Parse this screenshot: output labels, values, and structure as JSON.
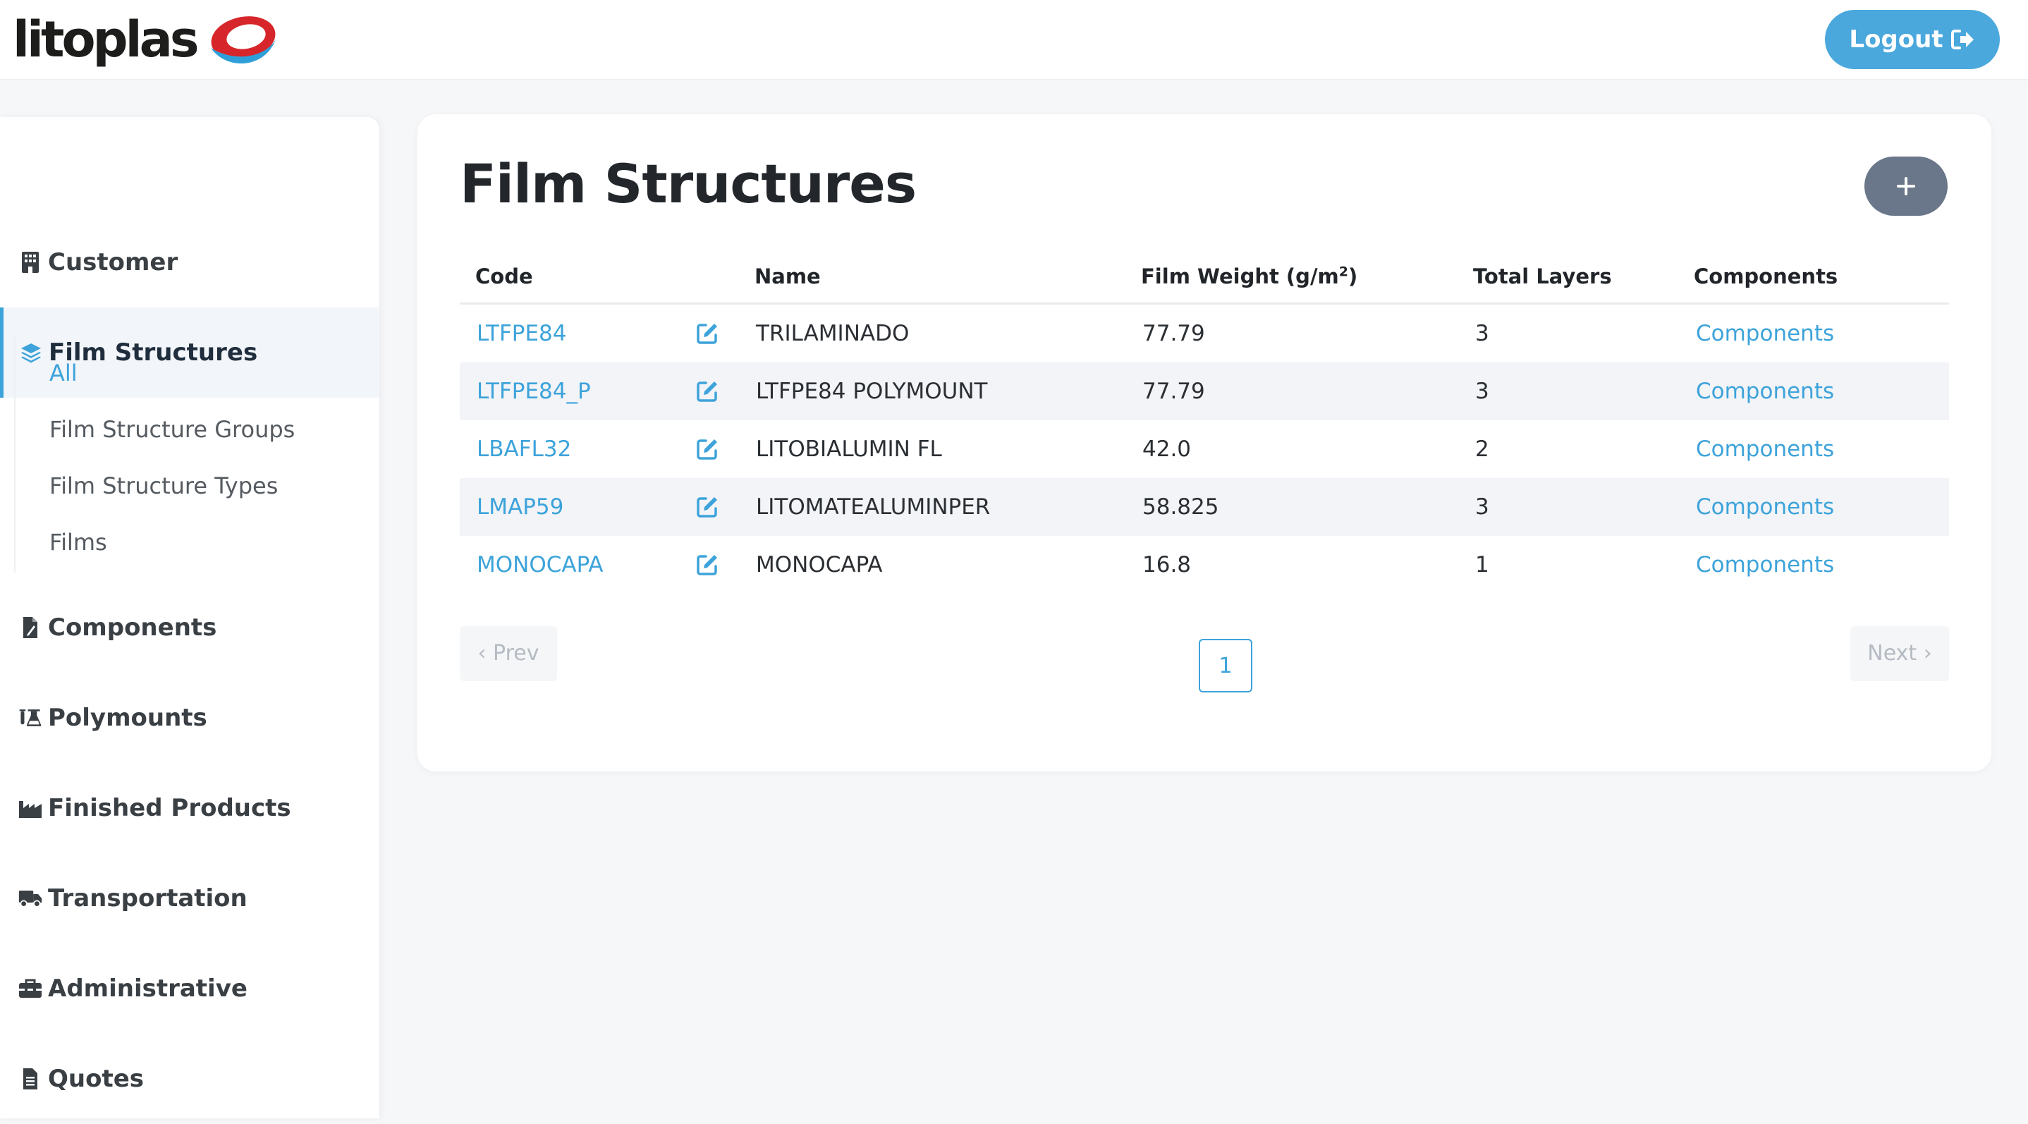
{
  "brand": {
    "name": "litoplas",
    "logo_colors": [
      "#d7262b",
      "#2f9fd9"
    ]
  },
  "header": {
    "logout_label": "Logout"
  },
  "sidebar": {
    "items": [
      {
        "label": "Customer",
        "icon": "building-icon"
      },
      {
        "label": "Film Structures",
        "icon": "layers-icon",
        "active": true
      },
      {
        "label": "Components",
        "icon": "file-icon"
      },
      {
        "label": "Polymounts",
        "icon": "flask-icon"
      },
      {
        "label": "Finished Products",
        "icon": "factory-icon"
      },
      {
        "label": "Transportation",
        "icon": "truck-icon"
      },
      {
        "label": "Administrative",
        "icon": "toolbox-icon"
      },
      {
        "label": "Quotes",
        "icon": "document-icon"
      }
    ],
    "subitems": [
      {
        "label": "All",
        "active": true
      },
      {
        "label": "Film Structure Groups"
      },
      {
        "label": "Film Structure Types"
      },
      {
        "label": "Films"
      }
    ]
  },
  "main": {
    "title": "Film Structures",
    "add_button_icon": "plus-icon",
    "table": {
      "headers": {
        "code": "Code",
        "name": "Name",
        "film_weight": "Film Weight (g/m",
        "film_weight_sup": "2",
        "film_weight_close": ")",
        "total_layers": "Total Layers",
        "components": "Components"
      },
      "rows": [
        {
          "code": "LTFPE84",
          "name": "TRILAMINADO",
          "film_weight": "77.79",
          "total_layers": "3",
          "components": "Components"
        },
        {
          "code": "LTFPE84_P",
          "name": "LTFPE84 POLYMOUNT",
          "film_weight": "77.79",
          "total_layers": "3",
          "components": "Components"
        },
        {
          "code": "LBAFL32",
          "name": "LITOBIALUMIN FL",
          "film_weight": "42.0",
          "total_layers": "2",
          "components": "Components"
        },
        {
          "code": "LMAP59",
          "name": "LITOMATEALUMINPER",
          "film_weight": "58.825",
          "total_layers": "3",
          "components": "Components"
        },
        {
          "code": "MONOCAPA",
          "name": "MONOCAPA",
          "film_weight": "16.8",
          "total_layers": "1",
          "components": "Components"
        }
      ]
    },
    "pagination": {
      "prev_label": "‹ Prev",
      "current_page": "1",
      "next_label": "Next ›"
    }
  },
  "colors": {
    "accent": "#3da3da",
    "logout_button": "#4aa8dd",
    "add_button": "#6a7689",
    "row_stripe": "#f2f4f8"
  }
}
